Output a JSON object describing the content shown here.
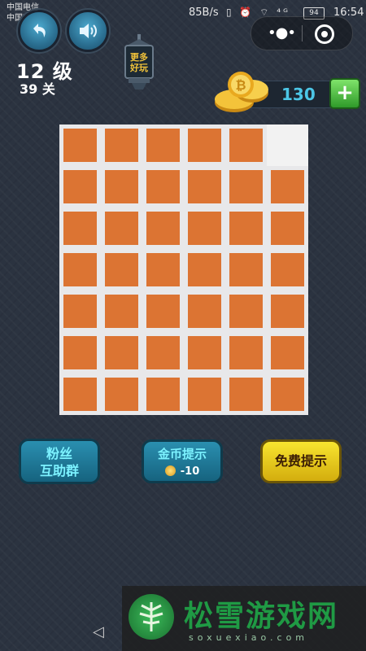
{
  "status": {
    "carrier1": "中国电信",
    "carrier2": "中国移动",
    "speed": "85B/s",
    "icons": "▯ ⏰ ⌔ ⁴ᴳ",
    "battery": "94",
    "time": "16:54"
  },
  "icons": {
    "back": "undo-arrow-icon",
    "sound": "speaker-icon",
    "more": "more-dots-icon",
    "close": "target-ring-icon",
    "plus": "plus-icon",
    "nav_back": "triangle-back-icon"
  },
  "header": {
    "level": "12 级",
    "stage": "39 关",
    "lantern_text": "更多好玩",
    "coins": "130",
    "plus_label": "+"
  },
  "board": {
    "cols": 6,
    "rows": 7,
    "colors": {
      "path": "#dc7433",
      "blank": "#f2f2f2",
      "grid": "#7b7f87"
    },
    "empty_cell": [
      5,
      0
    ]
  },
  "buttons": {
    "fans_line1": "粉丝",
    "fans_line2": "互助群",
    "coin_hint": "金币提示",
    "coin_cost": "-10",
    "free_hint": "免费提示"
  },
  "watermark": {
    "text": "松雪游戏网",
    "sub": "soxuexiao.com"
  }
}
